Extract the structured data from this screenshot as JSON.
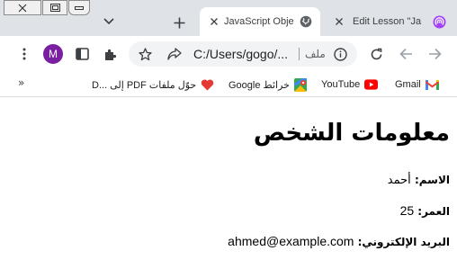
{
  "tabs": [
    {
      "label": "JavaScript Obje",
      "active": true
    },
    {
      "label": "Edit Lesson \"Ja",
      "active": false
    }
  ],
  "toolbar": {
    "avatar_letter": "M",
    "url": "C:/Users/gogo/...",
    "file_label": "ملف"
  },
  "bookmarks": [
    {
      "label": "Gmail",
      "icon": "gmail-icon"
    },
    {
      "label": "YouTube",
      "icon": "youtube-icon"
    },
    {
      "label": "خرائط Google",
      "icon": "maps-icon"
    },
    {
      "label": "حوّل ملفات PDF إلى ...D",
      "icon": "heart-icon"
    }
  ],
  "page": {
    "heading": "معلومات الشخص",
    "fields": [
      {
        "label": "الاسم:",
        "value": "أحمد"
      },
      {
        "label": "العمر:",
        "value": "25"
      },
      {
        "label": "البريد الإلكتروني:",
        "value": "ahmed@example.com"
      }
    ]
  },
  "colors": {
    "avatar": "#7b1fa2",
    "tabstrip": "#dfe3e7"
  }
}
